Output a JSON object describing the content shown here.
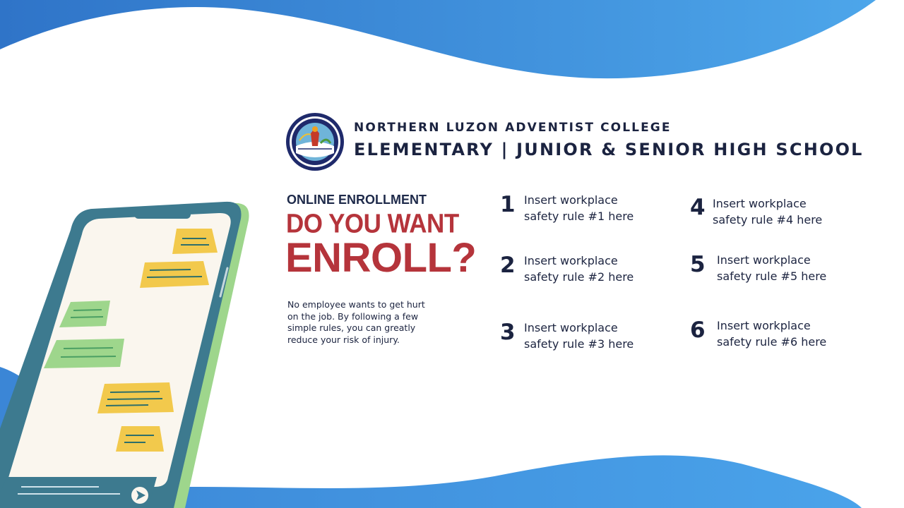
{
  "colors": {
    "wave_blue": "#4a90d9",
    "heading_red": "#b5343b",
    "navy": "#1b2340",
    "bubble_yellow": "#f2c94c",
    "bubble_green": "#9ed68c",
    "phone_frame": "#3d7a8f"
  },
  "school": {
    "name": "NORTHERN LUZON ADVENTIST COLLEGE",
    "divisions": "ELEMENTARY | JUNIOR & SENIOR HIGH SCHOOL"
  },
  "promo": {
    "kicker": "ONLINE ENROLLMENT",
    "headline_line1": "DO YOU WANT",
    "headline_line2": "ENROLL?",
    "body": "No employee wants to get hurt on the job. By following a few simple rules, you can greatly reduce your risk of injury."
  },
  "rules": [
    {
      "number": "1",
      "line1": "Insert workplace",
      "line2": "safety rule #1 here"
    },
    {
      "number": "2",
      "line1": "Insert workplace",
      "line2": "safety rule #2 here"
    },
    {
      "number": "3",
      "line1": "Insert workplace",
      "line2": "safety rule #3 here"
    },
    {
      "number": "4",
      "line1": "Insert workplace",
      "line2": "safety rule #4 here"
    },
    {
      "number": "5",
      "line1": "Insert workplace",
      "line2": "safety rule #5 here"
    },
    {
      "number": "6",
      "line1": "Insert workplace",
      "line2": "safety rule #6 here"
    }
  ],
  "icons": {
    "logo": "school-seal-icon",
    "send": "send-arrow-icon"
  }
}
